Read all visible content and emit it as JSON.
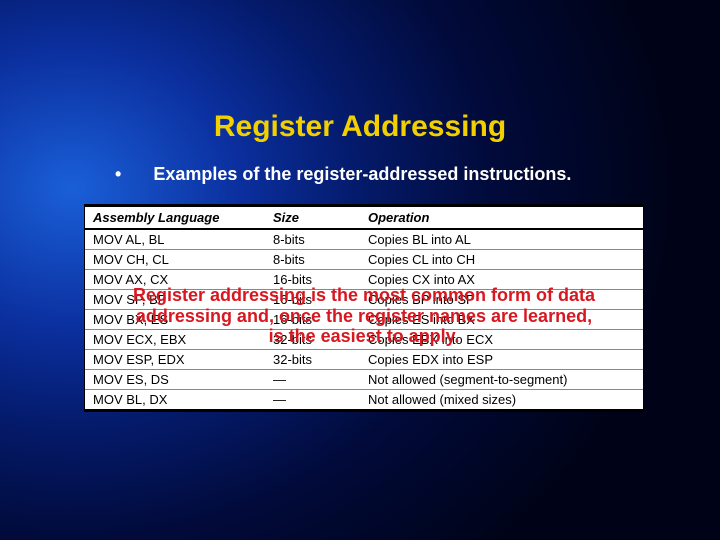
{
  "title": "Register Addressing",
  "bullet": {
    "marker": "•",
    "text": "Examples of the register-addressed instructions."
  },
  "table": {
    "headers": {
      "c1": "Assembly Language",
      "c2": "Size",
      "c3": "Operation"
    },
    "rows": [
      {
        "asm": "MOV AL, BL",
        "size": "8-bits",
        "op": "Copies BL into AL"
      },
      {
        "asm": "MOV CH, CL",
        "size": "8-bits",
        "op": "Copies CL into CH"
      },
      {
        "asm": "MOV AX, CX",
        "size": "16-bits",
        "op": "Copies CX into AX"
      },
      {
        "asm": "MOV SP, BP",
        "size": "16-bits",
        "op": "Copies BP into SP"
      },
      {
        "asm": "MOV BX, ES",
        "size": "16-bits",
        "op": "Copies ES into BX"
      },
      {
        "asm": "MOV ECX, EBX",
        "size": "32-bits",
        "op": "Copies EBX into ECX"
      },
      {
        "asm": "MOV ESP, EDX",
        "size": "32-bits",
        "op": "Copies EDX into ESP"
      },
      {
        "asm": "MOV ES, DS",
        "size": "—",
        "op": "Not allowed (segment-to-segment)"
      },
      {
        "asm": "MOV BL, DX",
        "size": "—",
        "op": "Not allowed (mixed sizes)"
      }
    ]
  },
  "overlay": {
    "line1": "Register addressing is the most common form of data",
    "line2": "addressing and, once the register names are learned,",
    "line3": "is the easiest to apply."
  }
}
